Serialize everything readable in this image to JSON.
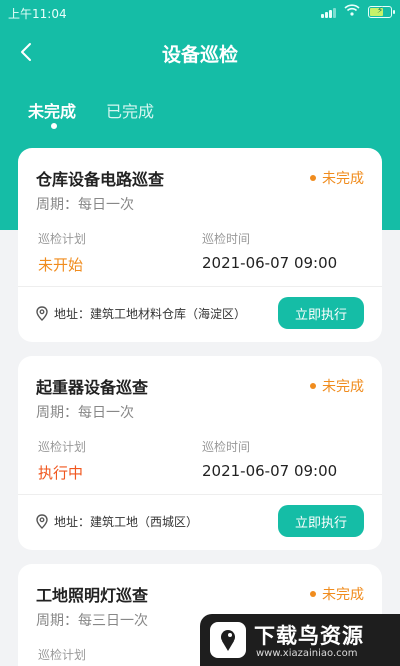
{
  "status_bar": {
    "time": "上午11:04"
  },
  "nav": {
    "title": "设备巡检"
  },
  "tabs": [
    {
      "label": "未完成",
      "active": true
    },
    {
      "label": "已完成",
      "active": false
    }
  ],
  "labels": {
    "plan": "巡检计划",
    "time": "巡检时间",
    "execute": "立即执行"
  },
  "cards": [
    {
      "title": "仓库设备电路巡查",
      "status": "未完成",
      "period": "周期：每日一次",
      "plan_value": "未开始",
      "time_value": "2021-06-07 09:00",
      "address": "地址：建筑工地材料仓库（海淀区）"
    },
    {
      "title": "起重器设备巡查",
      "status": "未完成",
      "period": "周期：每日一次",
      "plan_value": "执行中",
      "time_value": "2021-06-07 09:00",
      "address": "地址：建筑工地（西城区）"
    },
    {
      "title": "工地照明灯巡查",
      "status": "未完成",
      "period": "周期：每三日一次",
      "plan_value": "",
      "time_value": "",
      "address": ""
    }
  ],
  "watermark": {
    "title": "下载鸟资源",
    "url": "www.xiazainiao.com"
  },
  "colors": {
    "primary": "#15bda6",
    "pending": "#f08c1e",
    "running": "#f0561e",
    "background": "#f2f3f5"
  }
}
